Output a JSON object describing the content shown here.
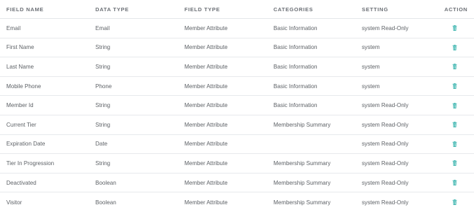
{
  "columns": {
    "field_name": "FIELD NAME",
    "data_type": "DATA TYPE",
    "field_type": "FIELD TYPE",
    "categories": "CATEGORIES",
    "setting": "SETTING",
    "action": "ACTION"
  },
  "icons": {
    "delete": "trash-icon"
  },
  "colors": {
    "accent": "#3fb6b0",
    "header_text": "#6b6f75",
    "row_text": "#5d6166",
    "divider": "#e7e9ec"
  },
  "rows": [
    {
      "field_name": "Email",
      "data_type": "Email",
      "field_type": "Member Attribute",
      "categories": "Basic Information",
      "setting": "system Read-Only"
    },
    {
      "field_name": "First Name",
      "data_type": "String",
      "field_type": "Member Attribute",
      "categories": "Basic Information",
      "setting": "system"
    },
    {
      "field_name": "Last Name",
      "data_type": "String",
      "field_type": "Member Attribute",
      "categories": "Basic Information",
      "setting": "system"
    },
    {
      "field_name": "Mobile Phone",
      "data_type": "Phone",
      "field_type": "Member Attribute",
      "categories": "Basic Information",
      "setting": "system"
    },
    {
      "field_name": "Member Id",
      "data_type": "String",
      "field_type": "Member Attribute",
      "categories": "Basic Information",
      "setting": "system Read-Only"
    },
    {
      "field_name": "Current Tier",
      "data_type": "String",
      "field_type": "Member Attribute",
      "categories": "Membership Summary",
      "setting": "system Read-Only"
    },
    {
      "field_name": "Expiration Date",
      "data_type": "Date",
      "field_type": "Member Attribute",
      "categories": "",
      "setting": "system Read-Only"
    },
    {
      "field_name": "Tier In Progression",
      "data_type": "String",
      "field_type": "Member Attribute",
      "categories": "Membership Summary",
      "setting": "system Read-Only"
    },
    {
      "field_name": "Deactivated",
      "data_type": "Boolean",
      "field_type": "Member Attribute",
      "categories": "Membership Summary",
      "setting": "system Read-Only"
    },
    {
      "field_name": "Visitor",
      "data_type": "Boolean",
      "field_type": "Member Attribute",
      "categories": "Membership Summary",
      "setting": "system Read-Only"
    }
  ]
}
